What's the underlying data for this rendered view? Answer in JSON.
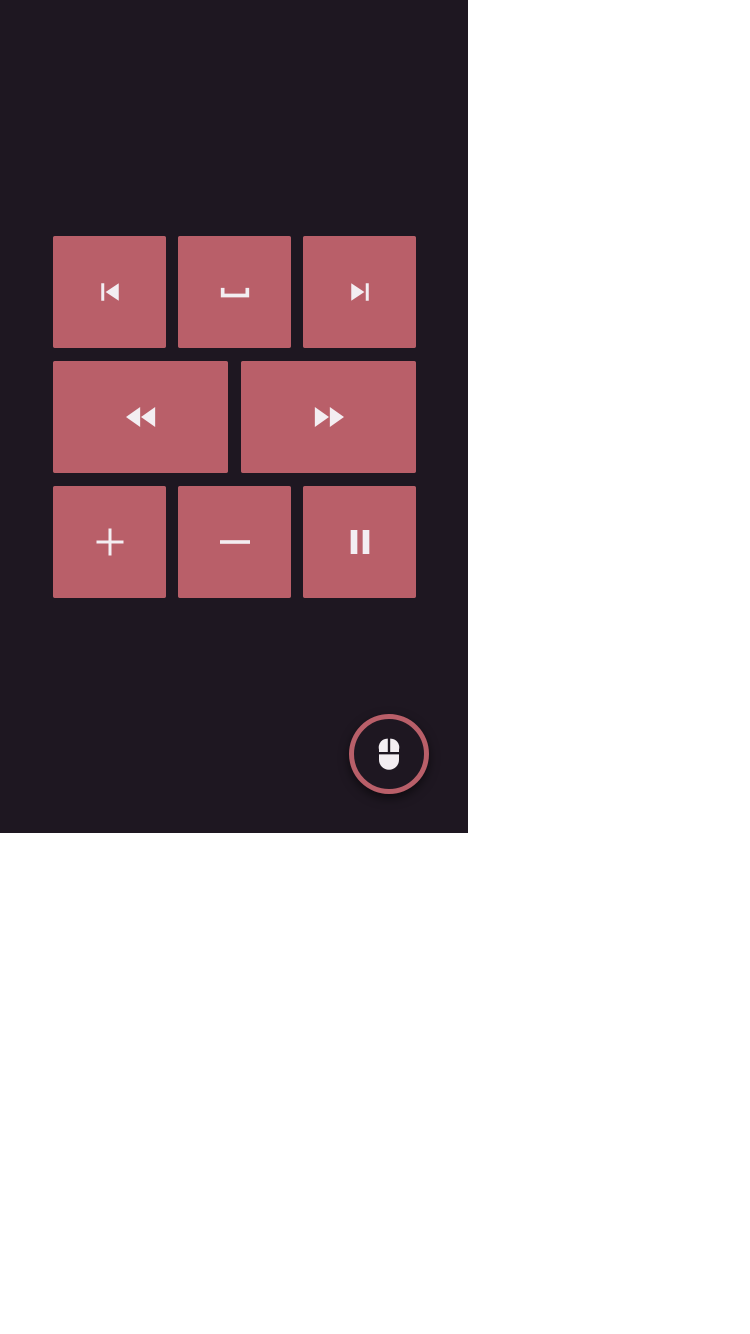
{
  "colors": {
    "background": "#1e1721",
    "key": "#b95f69",
    "icon": "#f3eef2",
    "page": "#ffffff"
  },
  "keypad": {
    "rows": [
      [
        {
          "action": "previous",
          "icon": "skip-previous-icon"
        },
        {
          "action": "space",
          "icon": "space-bar-icon"
        },
        {
          "action": "next",
          "icon": "skip-next-icon"
        }
      ],
      [
        {
          "action": "rewind",
          "icon": "rewind-icon"
        },
        {
          "action": "fast-forward",
          "icon": "fast-forward-icon"
        }
      ],
      [
        {
          "action": "volume-up",
          "icon": "plus-icon"
        },
        {
          "action": "volume-down",
          "icon": "minus-icon"
        },
        {
          "action": "pause",
          "icon": "pause-icon"
        }
      ]
    ]
  },
  "fab": {
    "action": "mouse-mode",
    "icon": "mouse-icon"
  }
}
